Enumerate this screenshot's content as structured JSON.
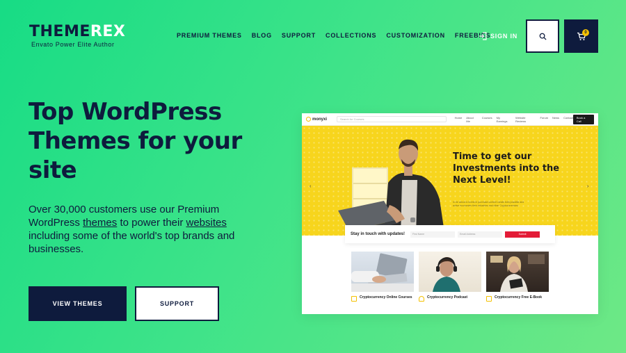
{
  "brand": {
    "word_a": "THEME",
    "word_b": "REX",
    "tagline": "Envato Power Elite Author"
  },
  "nav": {
    "items": [
      "PREMIUM THEMES",
      "BLOG",
      "SUPPORT",
      "COLLECTIONS",
      "CUSTOMIZATION",
      "FREEBIES"
    ],
    "signin": "SIGN IN",
    "cart_count": "0"
  },
  "hero": {
    "title": "Top WordPress Themes for your site",
    "desc_1": "Over 30,000 customers use our Premium WordPress ",
    "desc_link_1": "themes",
    "desc_2": " to power their ",
    "desc_link_2": "websites",
    "desc_3": " including some of the world's top brands and businesses.",
    "btn_primary": "VIEW THEMES",
    "btn_secondary": "SUPPORT"
  },
  "preview": {
    "logo": "monyxi",
    "search_placeholder": "Search for Courses",
    "menu": [
      "Home",
      "About Me",
      "Courses",
      "My Earnings",
      "Website Reviews",
      "Forum",
      "News",
      "Contact"
    ],
    "cta": "Book a Call",
    "hero_title": "Time to get our Investments into the Next Level!",
    "hero_sub": "In be about to invest in purchase content create both possible and active economies their industries and other Cryptocurrencies.",
    "subscribe_title": "Stay in touch with updates!",
    "field_1": "First Name",
    "field_2": "Email Address",
    "submit": "Submit",
    "cards": [
      {
        "title": "Cryptocurrency Online Courses"
      },
      {
        "title": "Cryptocurrency Podcast"
      },
      {
        "title": "Cryptocurrency Free E-Book"
      }
    ]
  },
  "colors": {
    "navy": "#0e1b3d",
    "green_start": "#17dc85",
    "green_end": "#6ee886",
    "preview_yellow": "#f7d51d",
    "badge_yellow": "#f4c000"
  }
}
